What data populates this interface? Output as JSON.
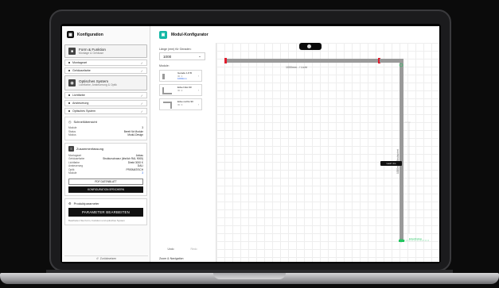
{
  "left": {
    "title": "Konfiguration",
    "sections": [
      {
        "title": "Form & Funktion",
        "subtitle": "Montage & Gehäuse"
      },
      {
        "title": "Optisches System",
        "subtitle": "Lichtfarbe, Ansteuerung & Optik"
      }
    ],
    "rows_a": [
      "Montageart",
      "Gehäusefarbe"
    ],
    "rows_b": [
      "Lichtfarbe",
      "Ansteuerung",
      "Optisches System"
    ],
    "overview": {
      "title": "Schnellübersicht",
      "items": [
        {
          "k": "Module",
          "v": "3"
        },
        {
          "k": "Status",
          "v": "Bereit für Module"
        },
        {
          "k": "Modus",
          "v": "Modul-Design"
        }
      ]
    },
    "summary": {
      "title": "Zusammenfassung",
      "items": [
        {
          "k": "Montageart",
          "v": "Anbau"
        },
        {
          "k": "Gehäusefarbe",
          "v": "Strukturschwarz (ähnlich RAL 9005)"
        },
        {
          "k": "Lichtfarbe",
          "v": "Direkt 3000 K"
        },
        {
          "k": "Ansteuerung",
          "v": "DALI"
        },
        {
          "k": "Optik",
          "v": "PRISMATISCH"
        },
        {
          "k": "Module",
          "v": "3"
        }
      ],
      "btn_pdf": "PDF DATENBLATT",
      "btn_save": "KONFIGURATION SPEICHERN"
    },
    "params": {
      "title": "Produktparameter",
      "button": "PARAMETER BEARBEITEN",
      "hint": "Bearbeiten Sie Form, Funktion und optisches System"
    },
    "back": "Zurücksetzen"
  },
  "module": {
    "title": "Modul-Konfigurator",
    "length_label": "Länge (mm) für Geraden:",
    "length_value": "1000",
    "modules_label": "Module:",
    "cards": [
      {
        "name": "Gerade 1.8 B",
        "line2": "ID: 1",
        "line3": "1000mm"
      },
      {
        "name": "Ecke links 90",
        "line2": "ID: 2",
        "line3": ""
      },
      {
        "name": "Ecke rechts 90",
        "line2": "ID: 3",
        "line3": ""
      }
    ],
    "undo": "Undo",
    "redo": "Redo",
    "zoom": "Zoom & Navigation"
  },
  "canvas": {
    "top_label": "1000mm - / Licht",
    "side_label": "1000mm - Strukturiert",
    "badge_label": "Eckverbindung",
    "tip_label": "Lauf: 4m"
  },
  "colors": {
    "accent": "#14b8a6",
    "line": "#9a9a9a",
    "red": "#e11d2e",
    "green": "#22c55e"
  }
}
